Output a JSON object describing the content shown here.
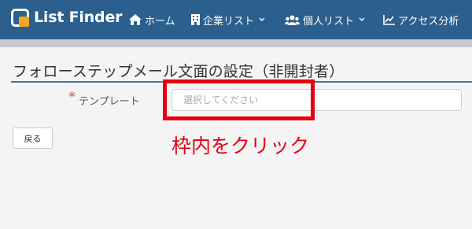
{
  "app": {
    "logo_text": "List Finder",
    "brand_color": "#2b5f8e",
    "logo_icon": "list-finder-logo-icon"
  },
  "nav": {
    "items": [
      {
        "label": "ホーム",
        "icon": "home-icon"
      },
      {
        "label": "企業リスト",
        "icon": "building-icon"
      },
      {
        "label": "個人リスト",
        "icon": "users-icon"
      },
      {
        "label": "アクセス分析",
        "icon": "chart-icon"
      }
    ]
  },
  "page": {
    "title": "フォローステップメール文面の設定（非開封者）"
  },
  "form": {
    "required_mark": "*",
    "template_label": "テンプレート",
    "template_placeholder": "選択してください"
  },
  "annotation": {
    "text": "枠内をクリック",
    "color": "#e60012"
  },
  "actions": {
    "back_label": "戻る"
  }
}
